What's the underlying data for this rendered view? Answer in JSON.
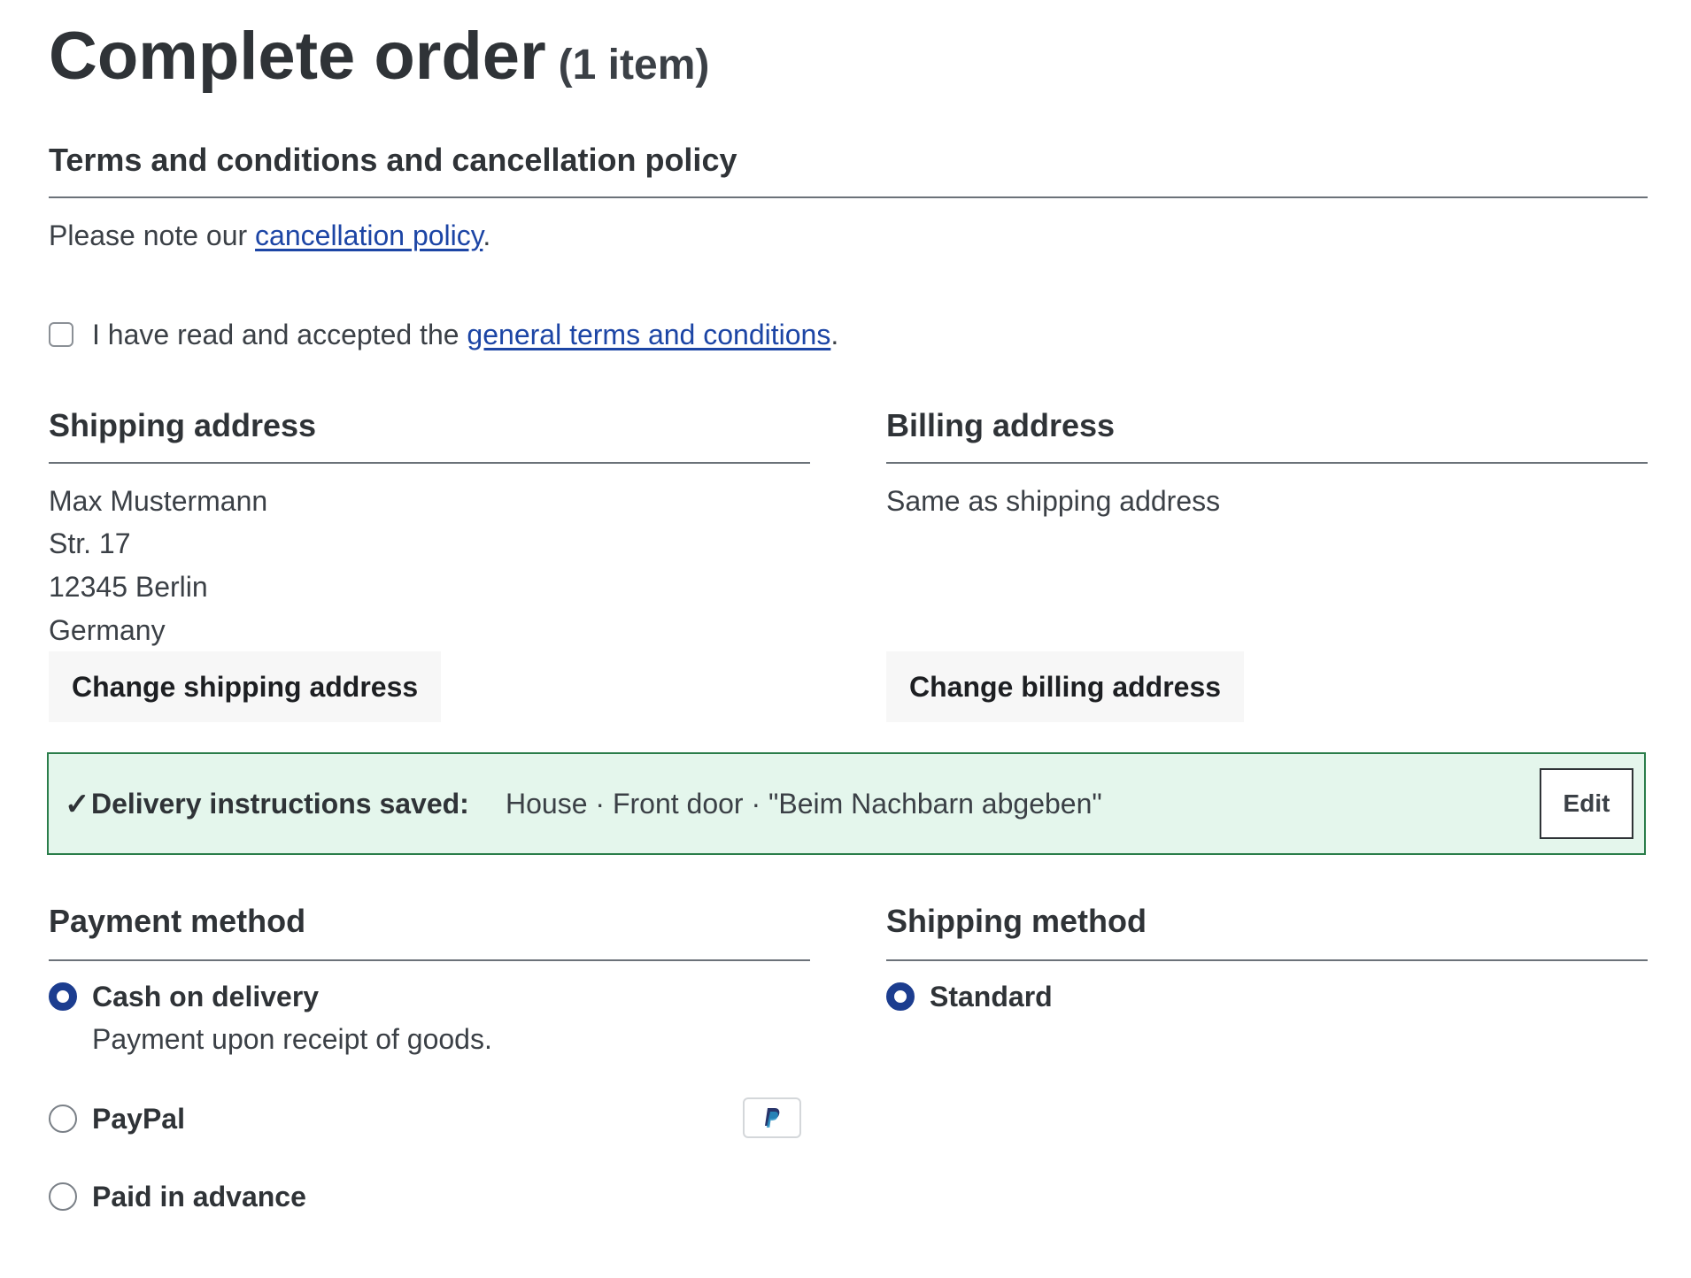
{
  "header": {
    "title": "Complete order",
    "item_count": "(1 item)"
  },
  "terms": {
    "heading": "Terms and conditions and cancellation policy",
    "note_prefix": "Please note our ",
    "cancellation_link": "cancellation policy",
    "note_suffix": ".",
    "checkbox_prefix": "I have read and accepted the ",
    "terms_link": "general terms and conditions",
    "checkbox_suffix": ".",
    "checkbox_checked": false
  },
  "shipping_address": {
    "heading": "Shipping address",
    "lines": [
      "Max Mustermann",
      "Str. 17",
      "12345 Berlin",
      "Germany"
    ],
    "change_button": "Change shipping address"
  },
  "billing_address": {
    "heading": "Billing address",
    "text": "Same as shipping address",
    "change_button": "Change billing address"
  },
  "delivery_notice": {
    "check_glyph": "✓",
    "label": "Delivery instructions saved:",
    "details": "House · Front door · \"Beim Nachbarn abgeben\"",
    "edit_button": "Edit",
    "background_color": "#e4f6ec",
    "border_color": "#2a7d4a"
  },
  "payment_method": {
    "heading": "Payment method",
    "options": [
      {
        "label": "Cash on delivery",
        "description": "Payment upon receipt of goods.",
        "selected": true
      },
      {
        "label": "PayPal",
        "icon": "paypal-icon",
        "selected": false
      },
      {
        "label": "Paid in advance",
        "selected": false
      }
    ]
  },
  "shipping_method": {
    "heading": "Shipping method",
    "options": [
      {
        "label": "Standard",
        "selected": true
      }
    ]
  },
  "colors": {
    "link": "#1c45a5",
    "radio_selected": "#1c3d8f",
    "text": "#2f3337"
  }
}
